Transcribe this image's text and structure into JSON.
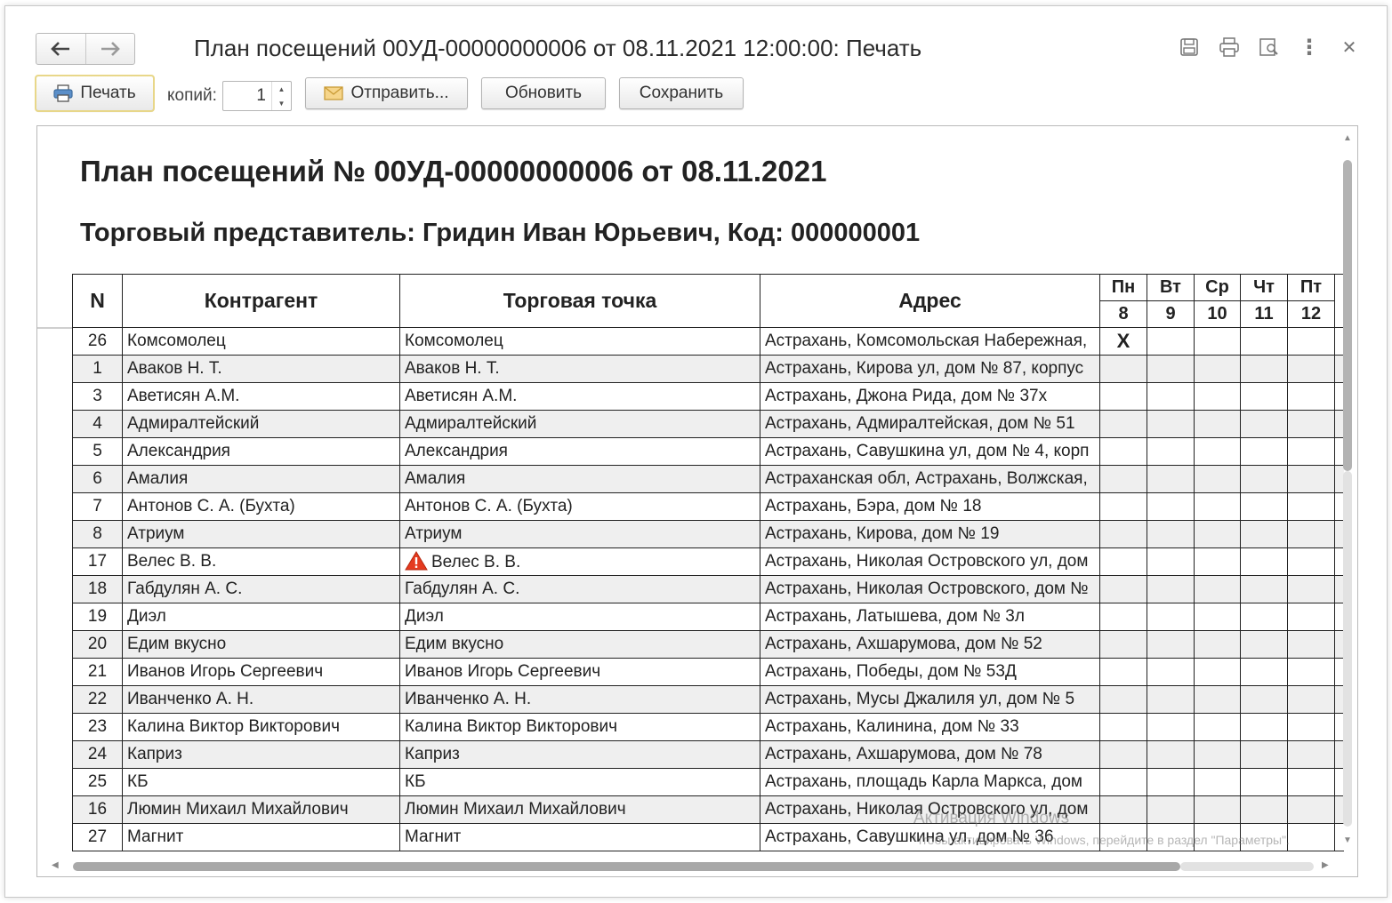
{
  "window": {
    "title": "План посещений 00УД-00000000006 от 08.11.2021 12:00:00: Печать",
    "nav_back": "🡐",
    "nav_forward": "🡒",
    "icons": [
      "save-icon",
      "print-icon",
      "preview-icon",
      "more-icon",
      "close-icon"
    ],
    "close_glyph": "✕",
    "more_glyph": "⋮"
  },
  "toolbar": {
    "print_label": "Печать",
    "copies_label": "копий:",
    "copies_value": "1",
    "send_label": "Отправить...",
    "refresh_label": "Обновить",
    "save_label": "Сохранить"
  },
  "document": {
    "title": "План посещений № 00УД-00000000006 от 08.11.2021",
    "subtitle": "Торговый представитель: Гридин Иван Юрьевич, Код: 000000001",
    "headers": {
      "n": "N",
      "counterparty": "Контрагент",
      "outlet": "Торговая точка",
      "address": "Адрес"
    },
    "days": [
      {
        "name": "Пн",
        "date": "8"
      },
      {
        "name": "Вт",
        "date": "9"
      },
      {
        "name": "Ср",
        "date": "10"
      },
      {
        "name": "Чт",
        "date": "11"
      },
      {
        "name": "Пт",
        "date": "12"
      }
    ],
    "rows": [
      {
        "n": "26",
        "counterparty": "Комсомолец",
        "outlet": "Комсомолец",
        "address": "Астрахань, Комсомольская Набережная,",
        "mon": "X",
        "warning": false
      },
      {
        "n": "1",
        "counterparty": "Аваков Н. Т.",
        "outlet": "Аваков Н. Т.",
        "address": "Астрахань, Кирова ул, дом № 87, корпус",
        "mon": "",
        "warning": false
      },
      {
        "n": "3",
        "counterparty": "Аветисян А.М.",
        "outlet": "Аветисян А.М.",
        "address": "Астрахань, Джона Рида, дом № 37х",
        "mon": "",
        "warning": false
      },
      {
        "n": "4",
        "counterparty": "Адмиралтейский",
        "outlet": "Адмиралтейский",
        "address": "Астрахань, Адмиралтейская, дом № 51",
        "mon": "",
        "warning": false
      },
      {
        "n": "5",
        "counterparty": "Александрия",
        "outlet": "Александрия",
        "address": "Астрахань, Савушкина ул, дом № 4, корп",
        "mon": "",
        "warning": false
      },
      {
        "n": "6",
        "counterparty": "Амалия",
        "outlet": "Амалия",
        "address": "Астраханская обл, Астрахань, Волжская,",
        "mon": "",
        "warning": false
      },
      {
        "n": "7",
        "counterparty": "Антонов С. А. (Бухта)",
        "outlet": "Антонов С. А. (Бухта)",
        "address": "Астрахань, Бэра, дом № 18",
        "mon": "",
        "warning": false
      },
      {
        "n": "8",
        "counterparty": "Атриум",
        "outlet": "Атриум",
        "address": "Астрахань, Кирова, дом № 19",
        "mon": "",
        "warning": false
      },
      {
        "n": "17",
        "counterparty": "Велес В. В.",
        "outlet": "Велес В. В.",
        "address": "Астрахань, Николая Островского ул, дом",
        "mon": "",
        "warning": true
      },
      {
        "n": "18",
        "counterparty": "Габдулян А. С.",
        "outlet": "Габдулян А. С.",
        "address": "Астрахань, Николая Островского, дом №",
        "mon": "",
        "warning": false
      },
      {
        "n": "19",
        "counterparty": "Диэл",
        "outlet": "Диэл",
        "address": "Астрахань, Латышева, дом № 3л",
        "mon": "",
        "warning": false
      },
      {
        "n": "20",
        "counterparty": "Едим вкусно",
        "outlet": "Едим вкусно",
        "address": "Астрахань, Ахшарумова, дом № 52",
        "mon": "",
        "warning": false
      },
      {
        "n": "21",
        "counterparty": "Иванов Игорь Сергеевич",
        "outlet": "Иванов Игорь Сергеевич",
        "address": "Астрахань, Победы, дом № 53Д",
        "mon": "",
        "warning": false
      },
      {
        "n": "22",
        "counterparty": "Иванченко А. Н.",
        "outlet": "Иванченко А. Н.",
        "address": "Астрахань, Мусы Джалиля ул, дом № 5",
        "mon": "",
        "warning": false
      },
      {
        "n": "23",
        "counterparty": "Калина Виктор Викторович",
        "outlet": "Калина Виктор Викторович",
        "address": "Астрахань, Калинина, дом № 33",
        "mon": "",
        "warning": false
      },
      {
        "n": "24",
        "counterparty": "Каприз",
        "outlet": "Каприз",
        "address": "Астрахань, Ахшарумова, дом № 78",
        "mon": "",
        "warning": false
      },
      {
        "n": "25",
        "counterparty": "КБ",
        "outlet": "КБ",
        "address": "Астрахань, площадь Карла Маркса, дом",
        "mon": "",
        "warning": false
      },
      {
        "n": "16",
        "counterparty": "Люмин Михаил Михайлович",
        "outlet": "Люмин Михаил Михайлович",
        "address": "Астрахань, Николая Островского ул, дом",
        "mon": "",
        "warning": false
      },
      {
        "n": "27",
        "counterparty": "Магнит",
        "outlet": "Магнит",
        "address": "Астрахань, Савушкина ул, дом № 36",
        "mon": "",
        "warning": false
      }
    ]
  },
  "watermark": {
    "line1": "Активация Windows",
    "line2": "Чтобы активировать Windows, перейдите в раздел \"Параметры\"."
  },
  "colors": {
    "print_focus": "#e8d789",
    "warning": "#e53a1f",
    "row_alt": "#efefef"
  }
}
